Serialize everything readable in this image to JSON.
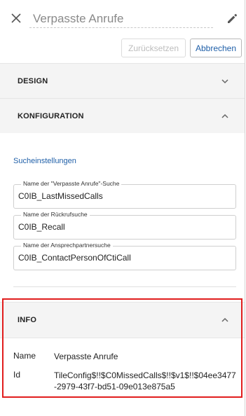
{
  "header": {
    "title_placeholder": "Verpasste Anrufe",
    "close_icon": "close-icon",
    "edit_icon": "pencil-icon"
  },
  "toolbar": {
    "reset_label": "Zurücksetzen",
    "cancel_label": "Abbrechen"
  },
  "sections": {
    "design": {
      "label": "DESIGN",
      "expanded": false
    },
    "konfiguration": {
      "label": "KONFIGURATION",
      "expanded": true
    },
    "info": {
      "label": "INFO",
      "expanded": true
    }
  },
  "konfiguration": {
    "subtitle": "Sucheinstellungen",
    "fields": [
      {
        "label": "Name der \"Verpasste Anrufe\"-Suche",
        "value": "C0IB_LastMissedCalls"
      },
      {
        "label": "Name der Rückrufsuche",
        "value": "C0IB_Recall"
      },
      {
        "label": "Name der Ansprechpartnersuche",
        "value": "C0IB_ContactPersonOfCtiCall"
      }
    ]
  },
  "info": {
    "name_key": "Name",
    "name_value": "Verpasste Anrufe",
    "id_key": "Id",
    "id_value": "TileConfig$!!$C0MissedCalls$!!$v1$!!$04ee3477-2979-43f7-bd51-09e013e875a5"
  },
  "colors": {
    "accent": "#1f5fa8",
    "highlight": "#e11d1d",
    "section_bg": "#f4f4f4"
  }
}
